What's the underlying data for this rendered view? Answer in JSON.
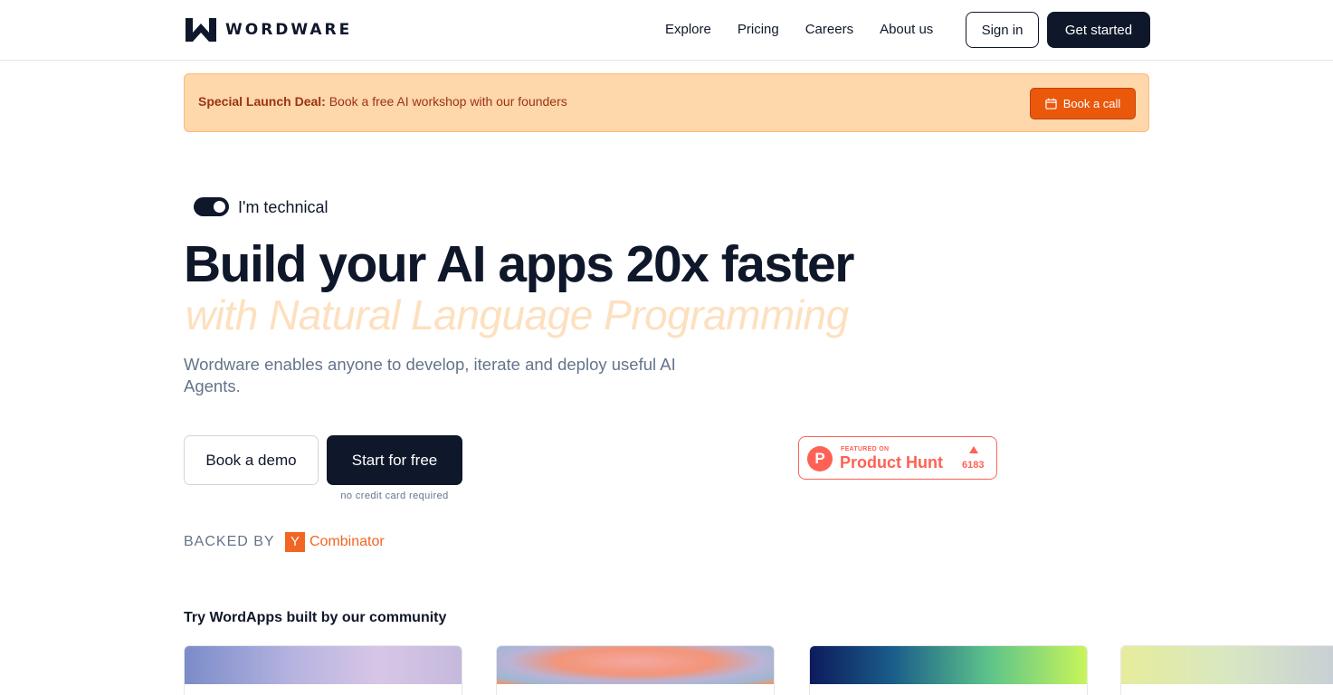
{
  "header": {
    "brand": "WORDWARE",
    "nav": [
      {
        "label": "Explore"
      },
      {
        "label": "Pricing"
      },
      {
        "label": "Careers"
      },
      {
        "label": "About us"
      }
    ],
    "sign_in": "Sign in",
    "get_started": "Get started"
  },
  "banner": {
    "highlight": "Special Launch Deal:",
    "text": "Book a free AI workshop with our founders",
    "button": "Book a call",
    "button_icon": "calendar-icon"
  },
  "hero": {
    "toggle_label": "I'm technical",
    "toggle_on": true,
    "title": "Build your AI apps 20x faster",
    "subtitle": "with Natural Language Programming",
    "description": "Wordware enables anyone to develop, iterate and deploy useful AI Agents.",
    "book_demo": "Book a demo",
    "start_free": "Start for free",
    "no_cc": "no credit card required"
  },
  "product_hunt": {
    "featured": "FEATURED ON",
    "name": "Product Hunt",
    "letter": "P",
    "votes": "6183"
  },
  "backed": {
    "label": "BACKED BY",
    "yc_letter": "Y",
    "yc_text": "Combinator"
  },
  "community": {
    "title": "Try WordApps built by our community"
  },
  "colors": {
    "primary": "#0f172a",
    "accent": "#ea580c",
    "banner_bg": "#fed7aa",
    "product_hunt": "#ff6154",
    "yc_orange": "#f26522"
  }
}
